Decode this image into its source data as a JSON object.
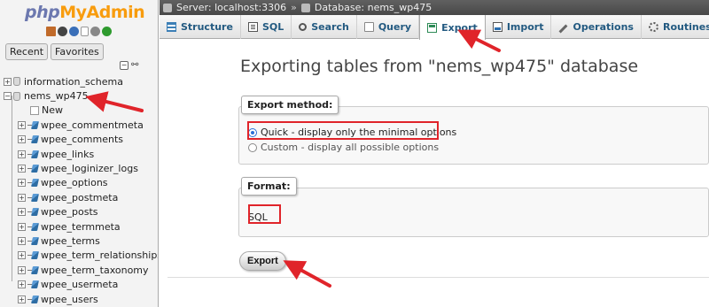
{
  "app": {
    "logo_php": "php",
    "logo_my": "My",
    "logo_admin": "Admin",
    "brand_color_php": "#6c78af",
    "brand_color_admin": "#f89c0e"
  },
  "sidebar": {
    "tabs": [
      "Recent",
      "Favorites"
    ],
    "quick_icons": [
      "home-icon",
      "exit-icon",
      "info-icon",
      "docs-icon",
      "settings-icon",
      "reload-icon"
    ],
    "databases": [
      {
        "name": "information_schema",
        "expanded": false
      },
      {
        "name": "nems_wp475",
        "expanded": true
      }
    ],
    "new_label": "New",
    "tables": [
      "wpee_commentmeta",
      "wpee_comments",
      "wpee_links",
      "wpee_loginizer_logs",
      "wpee_options",
      "wpee_postmeta",
      "wpee_posts",
      "wpee_termmeta",
      "wpee_terms",
      "wpee_term_relationships",
      "wpee_term_taxonomy",
      "wpee_usermeta",
      "wpee_users"
    ]
  },
  "breadcrumb": {
    "server": "Server: localhost:3306",
    "separator": "»",
    "database": "Database: nems_wp475"
  },
  "tabs": [
    {
      "label": "Structure",
      "icon": "structure-icon",
      "active": false
    },
    {
      "label": "SQL",
      "icon": "sql-icon",
      "active": false
    },
    {
      "label": "Search",
      "icon": "search-icon",
      "active": false
    },
    {
      "label": "Query",
      "icon": "query-icon",
      "active": false
    },
    {
      "label": "Export",
      "icon": "export-icon",
      "active": true
    },
    {
      "label": "Import",
      "icon": "import-icon",
      "active": false
    },
    {
      "label": "Operations",
      "icon": "operations-icon",
      "active": false
    },
    {
      "label": "Routines",
      "icon": "routines-icon",
      "active": false
    }
  ],
  "main": {
    "title": "Exporting tables from \"nems_wp475\" database",
    "export_method": {
      "legend": "Export method:",
      "options": [
        {
          "label": "Quick - display only the minimal options",
          "checked": true
        },
        {
          "label": "Custom - display all possible options",
          "checked": false
        }
      ]
    },
    "format": {
      "legend": "Format:",
      "value": "SQL"
    },
    "export_button": "Export"
  },
  "annotation_color": "#e0242a"
}
